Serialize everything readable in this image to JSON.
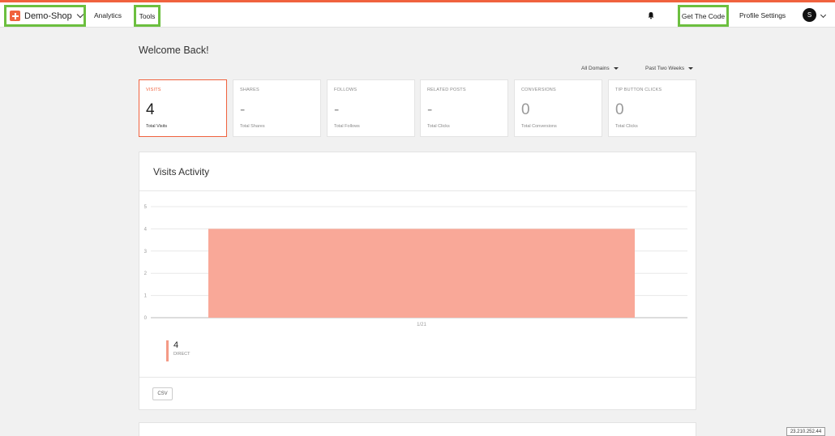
{
  "header": {
    "brand": "Demo-Shop",
    "nav": {
      "analytics": "Analytics",
      "tools": "Tools",
      "get_code": "Get The Code",
      "profile": "Profile Settings"
    },
    "avatar_initial": "S"
  },
  "page": {
    "welcome": "Welcome Back!",
    "filters": {
      "domains": "All Domains",
      "period": "Past Two Weeks"
    }
  },
  "stats": [
    {
      "title": "VISITS",
      "value": "4",
      "sub": "Total Visits"
    },
    {
      "title": "SHARES",
      "value": "-",
      "sub": "Total Shares"
    },
    {
      "title": "FOLLOWS",
      "value": "-",
      "sub": "Total Follows"
    },
    {
      "title": "RELATED POSTS",
      "value": "-",
      "sub": "Total Clicks"
    },
    {
      "title": "CONVERSIONS",
      "value": "0",
      "sub": "Total Conversions"
    },
    {
      "title": "TIP BUTTON CLICKS",
      "value": "0",
      "sub": "Total Clicks"
    }
  ],
  "activity": {
    "title": "Visits Activity",
    "csv_label": "CSV",
    "legend": {
      "value": "4",
      "label": "DIRECT"
    }
  },
  "chart_data": {
    "type": "area",
    "categories": [
      "1/21"
    ],
    "series": [
      {
        "name": "DIRECT",
        "values": [
          4
        ]
      }
    ],
    "ylim": [
      0,
      5
    ],
    "yticks": [
      "0",
      "1",
      "2",
      "3",
      "4",
      "5"
    ],
    "grid": true,
    "color": "#f9a898"
  },
  "footer": {
    "ip": "23.210.252.44"
  },
  "colors": {
    "accent": "#f0623e",
    "highlight": "#6cbf3f"
  }
}
